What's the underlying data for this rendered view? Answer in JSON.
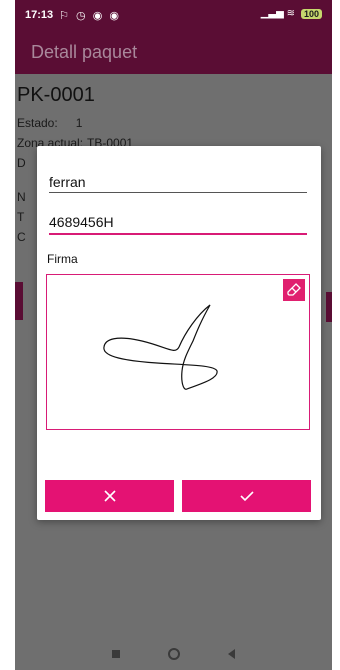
{
  "status_bar": {
    "time": "17:13",
    "notification_icons": "⚐ ◷ ◉ ◉",
    "signal": "▁▃▅ ≋",
    "battery": "100"
  },
  "app_bar": {
    "title": "Detall paquet"
  },
  "detail": {
    "package_id": "PK-0001",
    "estado_label": "Estado:",
    "estado_value": "1",
    "zona_label": "Zona actual:",
    "zona_value": "TB-0001",
    "partial_row_1": "D",
    "partial_row_2": "N",
    "partial_row_3": "T",
    "partial_row_4": "C"
  },
  "dialog": {
    "name_value": "ferran",
    "id_value": "4689456H",
    "firma_label": "Firma",
    "clear_icon": "eraser-icon",
    "cancel_icon": "close-icon",
    "confirm_icon": "check-icon"
  },
  "colors": {
    "primary_dark": "#5a0d34",
    "accent": "#e41273",
    "overlay": "#6f6f6f"
  }
}
